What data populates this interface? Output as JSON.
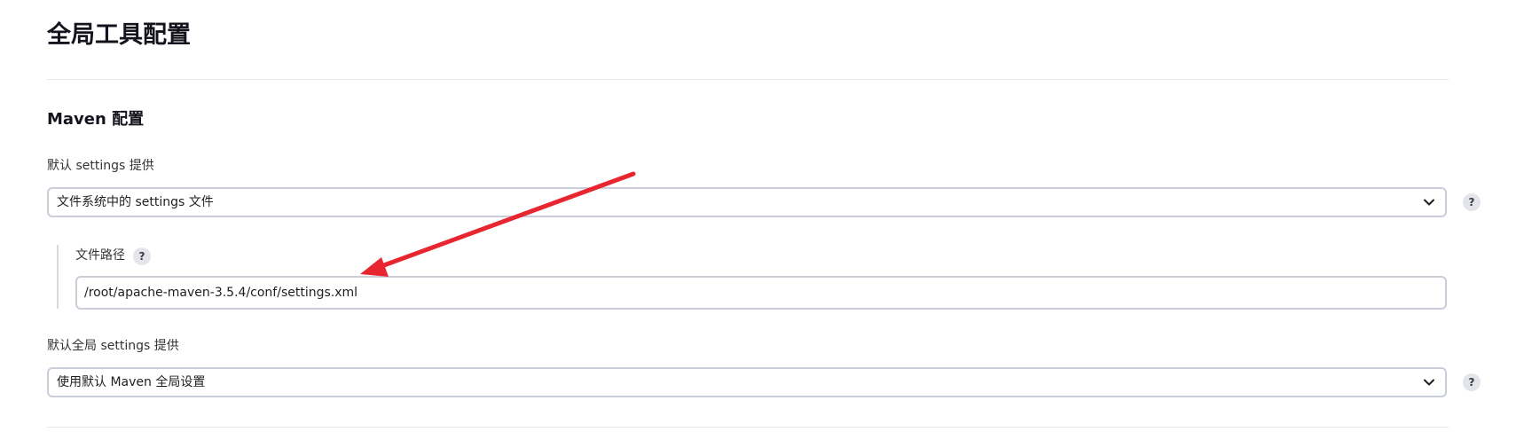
{
  "page": {
    "title": "全局工具配置"
  },
  "maven_section": {
    "title": "Maven 配置",
    "default_settings": {
      "label": "默认 settings 提供",
      "selected_value": "文件系统中的 settings 文件",
      "help": "?"
    },
    "file_path": {
      "label": "文件路径",
      "value": "/root/apache-maven-3.5.4/conf/settings.xml",
      "help": "?"
    },
    "global_settings": {
      "label": "默认全局 settings 提供",
      "selected_value": "使用默认 Maven 全局设置",
      "help": "?"
    }
  },
  "annotation": {
    "arrow_color": "#e8262f"
  },
  "icons": {
    "select_chevron": "chevron-down-icon",
    "help": "help-icon",
    "annotation": "red-arrow-icon"
  },
  "colors": {
    "input_border": "#c9ced8",
    "divider": "#e6e6ec",
    "help_bg": "#e4e5ea"
  }
}
